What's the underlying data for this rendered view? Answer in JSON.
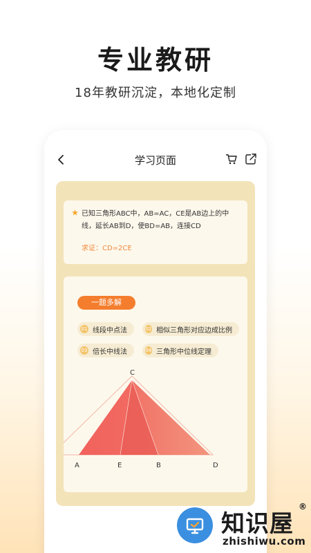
{
  "promo": {
    "title": "专业教研",
    "subtitle": "18年教研沉淀，本地化定制"
  },
  "nav": {
    "title": "学习页面"
  },
  "question": {
    "text": "已知三角形ABC中，AB=AC，CE是AB边上的中线，延长AB到D，使BD=AB，连接CD",
    "require": "求证：CD=2CE"
  },
  "solutions": {
    "badge": "一题多解",
    "methods": [
      {
        "num": "01",
        "label": "线段中点法"
      },
      {
        "num": "02",
        "label": "相似三角形对应边成比例"
      },
      {
        "num": "03",
        "label": "倍长中线法"
      },
      {
        "num": "04",
        "label": "三角形中位线定理"
      }
    ]
  },
  "diagram": {
    "points": {
      "A": "A",
      "E": "E",
      "B": "B",
      "D": "D",
      "C": "C"
    }
  },
  "watermark": {
    "name": "知识屋",
    "reg": "®",
    "domain": "zhishiwu.com"
  },
  "colors": {
    "accent": "#f47e2e",
    "panel": "#f3e3b9",
    "card": "#fdf8ec",
    "triangle": "#f0605a"
  }
}
